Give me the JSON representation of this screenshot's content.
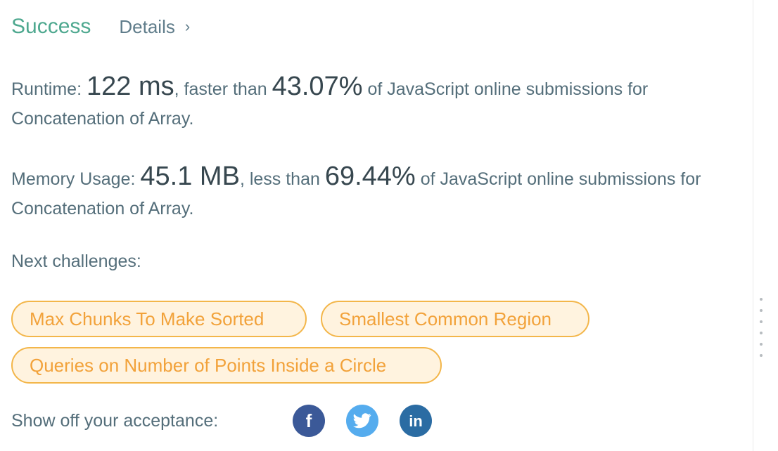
{
  "result": {
    "status": "Success",
    "details_label": "Details",
    "details_chevron": "›"
  },
  "runtime": {
    "label": "Runtime:",
    "value": "122 ms",
    "comparison": ", faster than",
    "percent": "43.07%",
    "suffix": "of JavaScript online submissions for Concatenation of Array."
  },
  "memory": {
    "label": "Memory Usage:",
    "value": "45.1 MB",
    "comparison": ", less than",
    "percent": "69.44%",
    "suffix": "of JavaScript online submissions for Concatenation of Array."
  },
  "next_challenges": {
    "label": "Next challenges:",
    "items": [
      "Max Chunks To Make Sorted",
      "Smallest Common Region",
      "Queries on Number of Points Inside a Circle"
    ]
  },
  "share": {
    "label": "Show off your acceptance:",
    "facebook_icon_text": "f",
    "linkedin_icon_text": "in",
    "icons": [
      "facebook-icon",
      "twitter-icon",
      "linkedin-icon"
    ]
  },
  "colors": {
    "success": "#4ea88f",
    "tag_border": "#f3b64a",
    "tag_background": "#fff3df",
    "tag_text": "#f2a23a",
    "facebook": "#3b5998",
    "twitter": "#55acee",
    "linkedin": "#2b6ca3"
  }
}
